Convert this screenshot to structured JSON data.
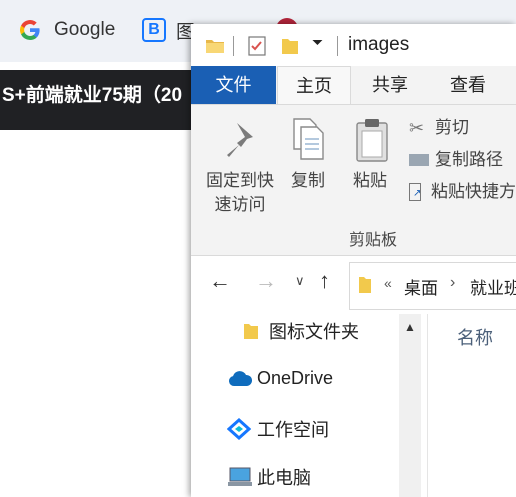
{
  "browser": {
    "bookmarks": [
      {
        "label": "Google",
        "icon": "google-icon"
      },
      {
        "label": "图",
        "icon": "b-app-icon"
      }
    ],
    "tab_title": "S+前端就业75期（20"
  },
  "explorer": {
    "title": "images",
    "tabs": {
      "file": "文件",
      "home": "主页",
      "share": "共享",
      "view": "查看"
    },
    "ribbon": {
      "pin_label": "固定到快速访问",
      "copy_label": "复制",
      "paste_label": "粘贴",
      "cut_label": "剪切",
      "copy_path_label": "复制路径",
      "paste_shortcut_label": "粘贴快捷方",
      "group_label": "剪贴板"
    },
    "address": {
      "overflow": "«",
      "crumbs": [
        "桌面",
        "就业班"
      ]
    },
    "nav_pane": [
      {
        "label": "图标文件夹",
        "icon": "folder-icon"
      },
      {
        "label": "OneDrive",
        "icon": "onedrive-icon"
      },
      {
        "label": "工作空间",
        "icon": "workspace-icon"
      },
      {
        "label": "此电脑",
        "icon": "pc-icon"
      }
    ],
    "column_header": "名称"
  },
  "colors": {
    "file_tab": "#1a5fb4",
    "accent": "#0063b1",
    "folder": "#f8d775",
    "dark_bar": "#202124"
  }
}
